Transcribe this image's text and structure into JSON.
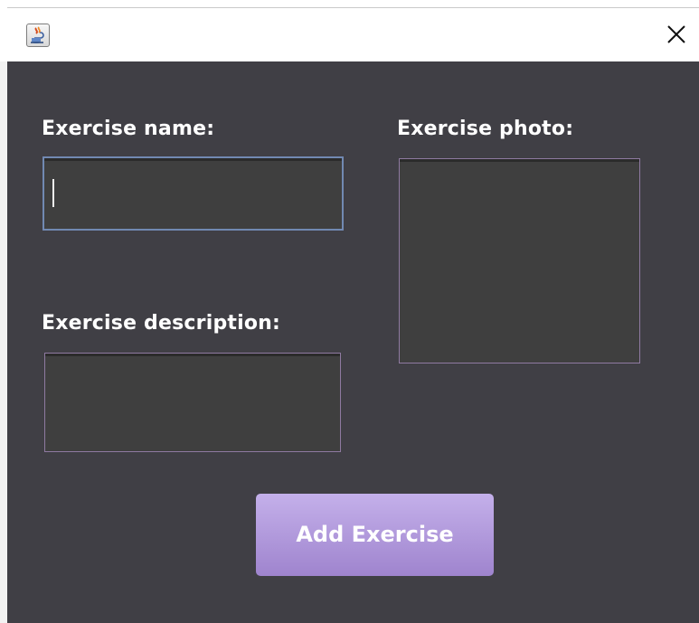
{
  "window": {
    "title": "",
    "app_icon": "java-cup-icon",
    "close_icon": "close-icon"
  },
  "form": {
    "exercise_name_label": "Exercise name:",
    "exercise_name_value": "",
    "exercise_description_label": "Exercise description:",
    "exercise_description_value": "",
    "exercise_photo_label": "Exercise photo:",
    "add_button_label": "Add Exercise"
  },
  "colors": {
    "panel_background": "#403f45",
    "field_background": "#3f3f3f",
    "focused_border": "#7189b2",
    "field_border": "#8f7aa1",
    "button_top": "#c4b0ea",
    "button_bottom": "#9f84ce",
    "label_text": "#ffffff"
  }
}
